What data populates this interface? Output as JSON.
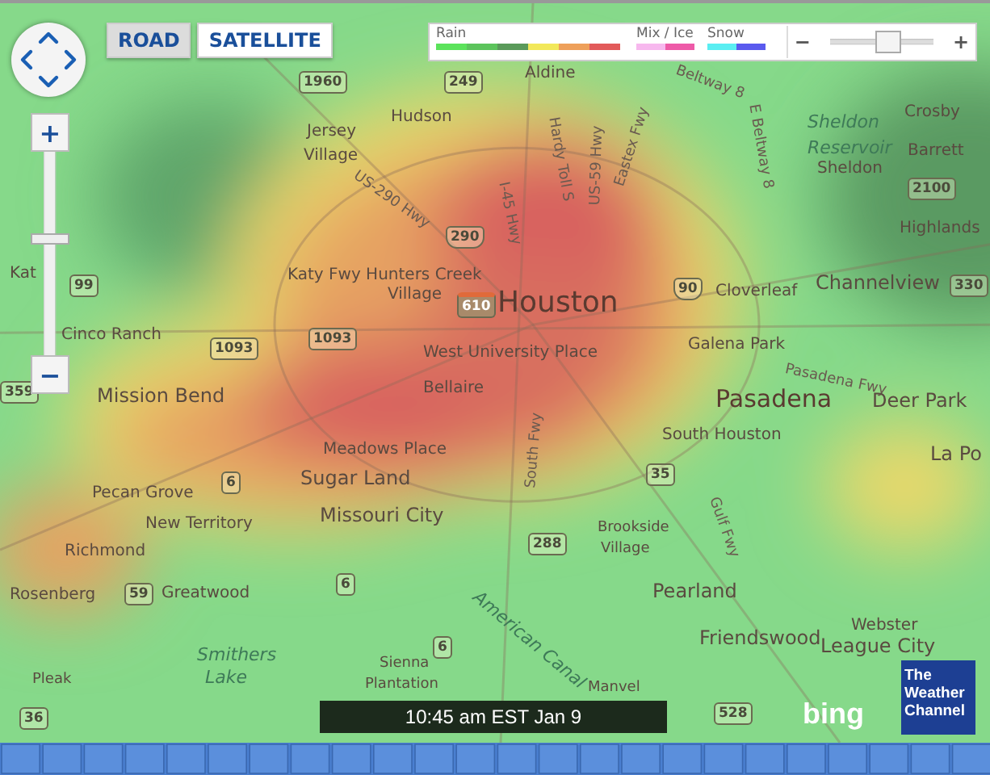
{
  "map_type_buttons": [
    {
      "label": "ROAD",
      "selected": true
    },
    {
      "label": "SATELLITE",
      "selected": false
    }
  ],
  "zoom": {
    "plus": "+",
    "minus": "−",
    "level": 0.57
  },
  "legend": {
    "groups": [
      {
        "label": "Rain",
        "swatches": [
          {
            "color": "#5be35b"
          },
          {
            "color": "#5cc45c"
          },
          {
            "color": "#5a9a5a"
          },
          {
            "color": "#f2e85a"
          },
          {
            "color": "#eea05a"
          },
          {
            "color": "#e25a5a"
          }
        ]
      },
      {
        "label": "Mix / Ice",
        "swatches": [
          {
            "color": "#f7b8ee"
          },
          {
            "color": "#ee5aa8"
          }
        ]
      },
      {
        "label": "Snow",
        "swatches": [
          {
            "color": "#5aeef2"
          },
          {
            "color": "#5a5aee"
          }
        ]
      }
    ],
    "opacity": {
      "minus": "−",
      "plus": "+",
      "level": 0.55
    }
  },
  "map": {
    "labels": [
      {
        "kind": "road",
        "text": "Beltway 8"
      },
      {
        "kind": "place",
        "text": "Aldine"
      },
      {
        "kind": "place",
        "text": "Hudson"
      },
      {
        "kind": "place",
        "text": "Jersey"
      },
      {
        "kind": "place",
        "text": "Village"
      },
      {
        "kind": "road",
        "text": "US-290 Hwy"
      },
      {
        "kind": "road",
        "text": "Hardy Toll S"
      },
      {
        "kind": "road",
        "text": "Eastex Fwy"
      },
      {
        "kind": "road",
        "text": "I-45 Hwy"
      },
      {
        "kind": "road",
        "text": "US-59 Hwy"
      },
      {
        "kind": "road",
        "text": "E Beltway 8"
      },
      {
        "kind": "place",
        "text": "Crosby"
      },
      {
        "kind": "water",
        "text": "Sheldon"
      },
      {
        "kind": "water",
        "text": "Reservoir"
      },
      {
        "kind": "place",
        "text": "Barrett"
      },
      {
        "kind": "place",
        "text": "Sheldon"
      },
      {
        "kind": "place",
        "text": "Highlands"
      },
      {
        "kind": "place",
        "text": "Kat"
      },
      {
        "kind": "place",
        "text": "Katy Fwy Hunters Creek"
      },
      {
        "kind": "place",
        "text": "Village"
      },
      {
        "kind": "city",
        "text": "Houston"
      },
      {
        "kind": "place",
        "text": "Cloverleaf"
      },
      {
        "kind": "town",
        "text": "Channelview"
      },
      {
        "kind": "place",
        "text": "Cinco Ranch"
      },
      {
        "kind": "place",
        "text": "West University Place"
      },
      {
        "kind": "place",
        "text": "Galena Park"
      },
      {
        "kind": "road",
        "text": "Pasadena Fwy"
      },
      {
        "kind": "place",
        "text": "Bellaire"
      },
      {
        "kind": "town",
        "text": "Mission Bend"
      },
      {
        "kind": "bigcity",
        "text": "Pasadena"
      },
      {
        "kind": "town",
        "text": "Deer Park"
      },
      {
        "kind": "place",
        "text": "South Houston"
      },
      {
        "kind": "town",
        "text": "La Po"
      },
      {
        "kind": "place",
        "text": "Meadows Place"
      },
      {
        "kind": "town",
        "text": "Sugar Land"
      },
      {
        "kind": "place",
        "text": "Pecan Grove"
      },
      {
        "kind": "place",
        "text": "New Territory"
      },
      {
        "kind": "town",
        "text": "Missouri City"
      },
      {
        "kind": "place",
        "text": "Richmond"
      },
      {
        "kind": "small",
        "text": "Brookside"
      },
      {
        "kind": "small",
        "text": "Village"
      },
      {
        "kind": "road",
        "text": "South Fwy"
      },
      {
        "kind": "road",
        "text": "Gulf Fwy"
      },
      {
        "kind": "place",
        "text": "Rosenberg"
      },
      {
        "kind": "place",
        "text": "Greatwood"
      },
      {
        "kind": "town",
        "text": "Pearland"
      },
      {
        "kind": "town",
        "text": "Friendswood"
      },
      {
        "kind": "place",
        "text": "Webster"
      },
      {
        "kind": "water",
        "text": "Smithers"
      },
      {
        "kind": "town",
        "text": "League City"
      },
      {
        "kind": "small",
        "text": "Pleak"
      },
      {
        "kind": "water",
        "text": "Lake"
      },
      {
        "kind": "water",
        "text": "American Canal"
      },
      {
        "kind": "small",
        "text": "Sienna"
      },
      {
        "kind": "small",
        "text": "Plantation"
      },
      {
        "kind": "small",
        "text": "Manvel"
      },
      {
        "kind": "shield",
        "text": "1960"
      },
      {
        "kind": "shield",
        "text": "249"
      },
      {
        "kind": "ushield",
        "text": "290"
      },
      {
        "kind": "shield",
        "text": "2100"
      },
      {
        "kind": "shield",
        "text": "99"
      },
      {
        "kind": "ishield",
        "text": "610"
      },
      {
        "kind": "ushield",
        "text": "90"
      },
      {
        "kind": "shield",
        "text": "330"
      },
      {
        "kind": "shield",
        "text": "1093"
      },
      {
        "kind": "shield",
        "text": "1093"
      },
      {
        "kind": "shield",
        "text": "359"
      },
      {
        "kind": "shield",
        "text": "6"
      },
      {
        "kind": "shield",
        "text": "35"
      },
      {
        "kind": "shield",
        "text": "288"
      },
      {
        "kind": "shield",
        "text": "6"
      },
      {
        "kind": "shield",
        "text": "59"
      },
      {
        "kind": "shield",
        "text": "6"
      },
      {
        "kind": "shield",
        "text": "36"
      },
      {
        "kind": "shield",
        "text": "528"
      }
    ]
  },
  "timestamp": "10:45 am EST Jan 9",
  "bing_logo": "bing",
  "brand_logo": "The Weather Channel"
}
